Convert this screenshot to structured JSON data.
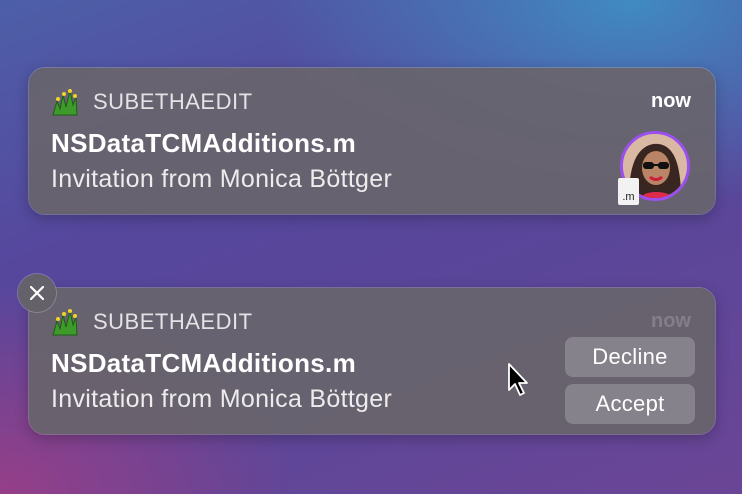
{
  "notifications": [
    {
      "app_name": "SUBETHAEDIT",
      "time": "now",
      "title": "NSDataTCMAdditions.m",
      "body": "Invitation from Monica Böttger",
      "file_badge": ".m",
      "app_icon": "subethaedit-leaf-icon",
      "avatar_ring_color": "#9b4ff0"
    },
    {
      "app_name": "SUBETHAEDIT",
      "time": "now",
      "title": "NSDataTCMAdditions.m",
      "body": "Invitation from Monica Böttger",
      "actions": {
        "decline": "Decline",
        "accept": "Accept"
      },
      "close_icon": "close-icon"
    }
  ]
}
